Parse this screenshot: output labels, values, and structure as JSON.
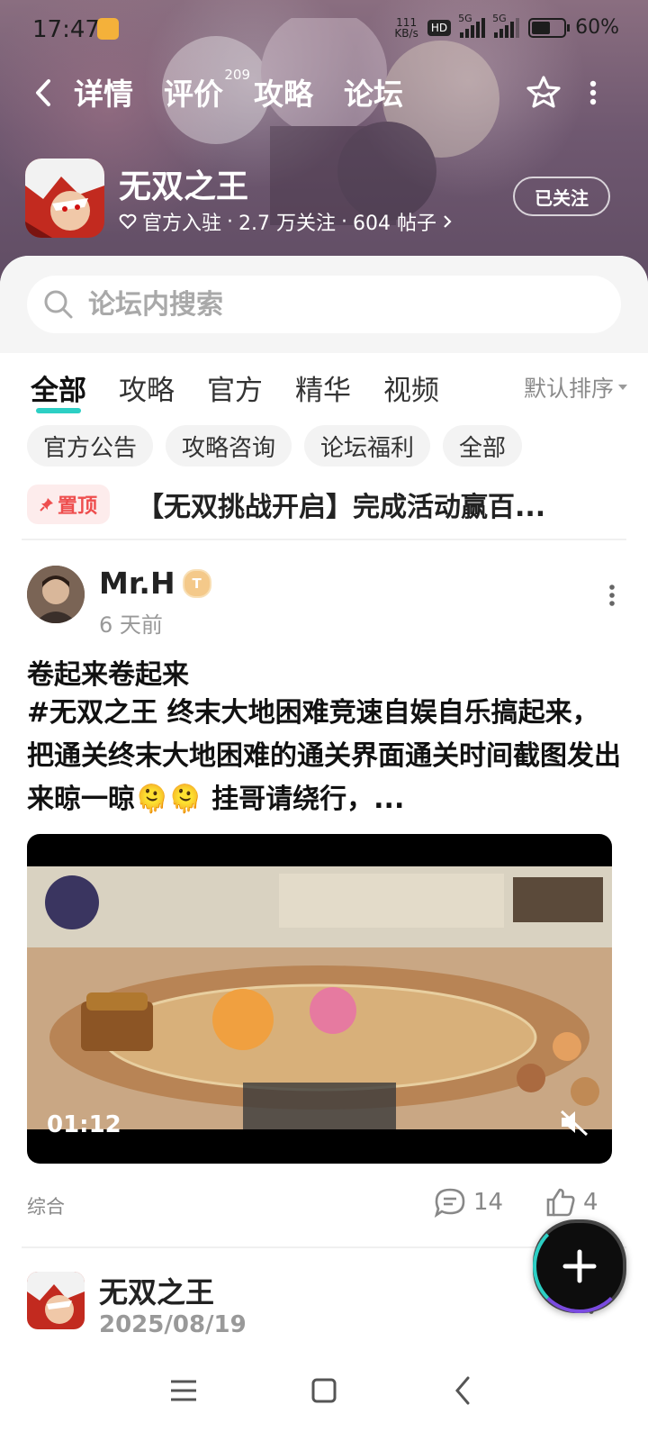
{
  "status_bar": {
    "time": "17:47",
    "net_speed_value": "111",
    "net_speed_unit": "KB/s",
    "hd": "HD",
    "signal1": "5G",
    "signal2": "5G",
    "battery": "60%",
    "battery_level": 0.6
  },
  "nav": {
    "tabs": [
      {
        "label": "详情"
      },
      {
        "label": "评价",
        "count": "209"
      },
      {
        "label": "攻略"
      },
      {
        "label": "论坛"
      }
    ]
  },
  "game": {
    "name": "无双之王",
    "official": "官方入驻",
    "followers": "2.7 万关注",
    "posts": "604 帖子",
    "sep": "·",
    "follow_label": "已关注"
  },
  "search": {
    "placeholder": "论坛内搜索"
  },
  "categories": {
    "tabs": [
      "全部",
      "攻略",
      "官方",
      "精华",
      "视频"
    ],
    "sort": "默认排序"
  },
  "chips": [
    "官方公告",
    "攻略咨询",
    "论坛福利",
    "全部"
  ],
  "pinned": {
    "badge": "置顶",
    "title": "【无双挑战开启】完成活动赢百..."
  },
  "post": {
    "author": "Mr.H",
    "level": "T",
    "time": "6 天前",
    "title": "卷起来卷起来",
    "body": "#无双之王 终末大地困难竞速自娱自乐搞起来，把通关终末大地困难的通关界面通关时间截图发出来晾一晾🫠🫠  挂哥请绕行，...",
    "video_duration": "01:12",
    "category": "综合",
    "comments": "14",
    "likes": "4"
  },
  "post2": {
    "author": "无双之王",
    "time": "2025/08/19"
  },
  "colors": {
    "accent": "#2ccfc4",
    "pin_red": "#ee4e4e",
    "header_bg": "#6f5870"
  }
}
